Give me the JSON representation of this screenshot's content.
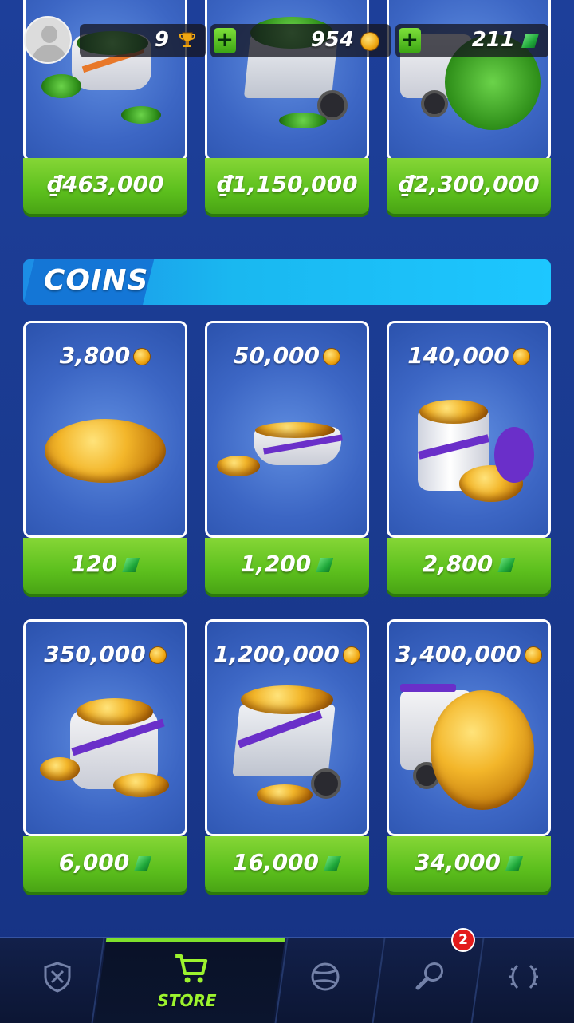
{
  "top_bar": {
    "trophies": "9",
    "coins": "954",
    "gems": "211",
    "add_coins_label": "+",
    "add_gems_label": "+"
  },
  "gem_packs": [
    {
      "price": "₫463,000"
    },
    {
      "price": "₫1,150,000"
    },
    {
      "price": "₫2,300,000"
    }
  ],
  "section": {
    "title": "COINS"
  },
  "coin_packs": [
    {
      "amount": "3,800",
      "price": "120"
    },
    {
      "amount": "50,000",
      "price": "1,200"
    },
    {
      "amount": "140,000",
      "price": "2,800"
    },
    {
      "amount": "350,000",
      "price": "6,000"
    },
    {
      "amount": "1,200,000",
      "price": "16,000"
    },
    {
      "amount": "3,400,000",
      "price": "34,000"
    }
  ],
  "nav": {
    "store_label": "STORE",
    "notification_count": "2"
  },
  "colors": {
    "accent_green": "#5cbf1d",
    "section_blue": "#1ab8f0",
    "background": "#1a3a8f",
    "active_nav": "#9cf32e"
  }
}
